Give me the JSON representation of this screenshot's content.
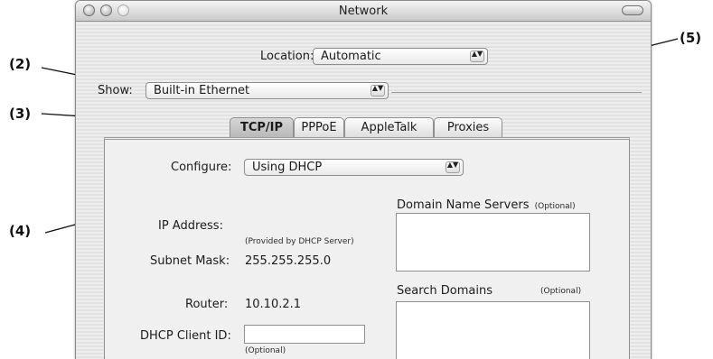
{
  "callouts": [
    "(2)",
    "(3)",
    "(4)",
    "(5)"
  ],
  "window": {
    "title": "Network"
  },
  "location": {
    "label": "Location:",
    "value": "Automatic"
  },
  "show": {
    "label": "Show:",
    "value": "Built-in Ethernet"
  },
  "tabs": [
    {
      "label": "TCP/IP",
      "active": true
    },
    {
      "label": "PPPoE",
      "active": false
    },
    {
      "label": "AppleTalk",
      "active": false
    },
    {
      "label": "Proxies",
      "active": false
    }
  ],
  "configure": {
    "label": "Configure:",
    "value": "Using DHCP"
  },
  "ip_address": {
    "label": "IP Address:",
    "note": "(Provided by DHCP Server)"
  },
  "subnet_mask": {
    "label": "Subnet Mask:",
    "value": "255.255.255.0"
  },
  "router": {
    "label": "Router:",
    "value": "10.10.2.1"
  },
  "dhcp_client_id": {
    "label": "DHCP Client ID:",
    "value": "",
    "note": "(Optional)"
  },
  "dns": {
    "label": "Domain Name Servers",
    "optional": "(Optional)"
  },
  "search_domains": {
    "label": "Search Domains",
    "optional": "(Optional)"
  },
  "popup_arrows_glyph": "▲▼"
}
